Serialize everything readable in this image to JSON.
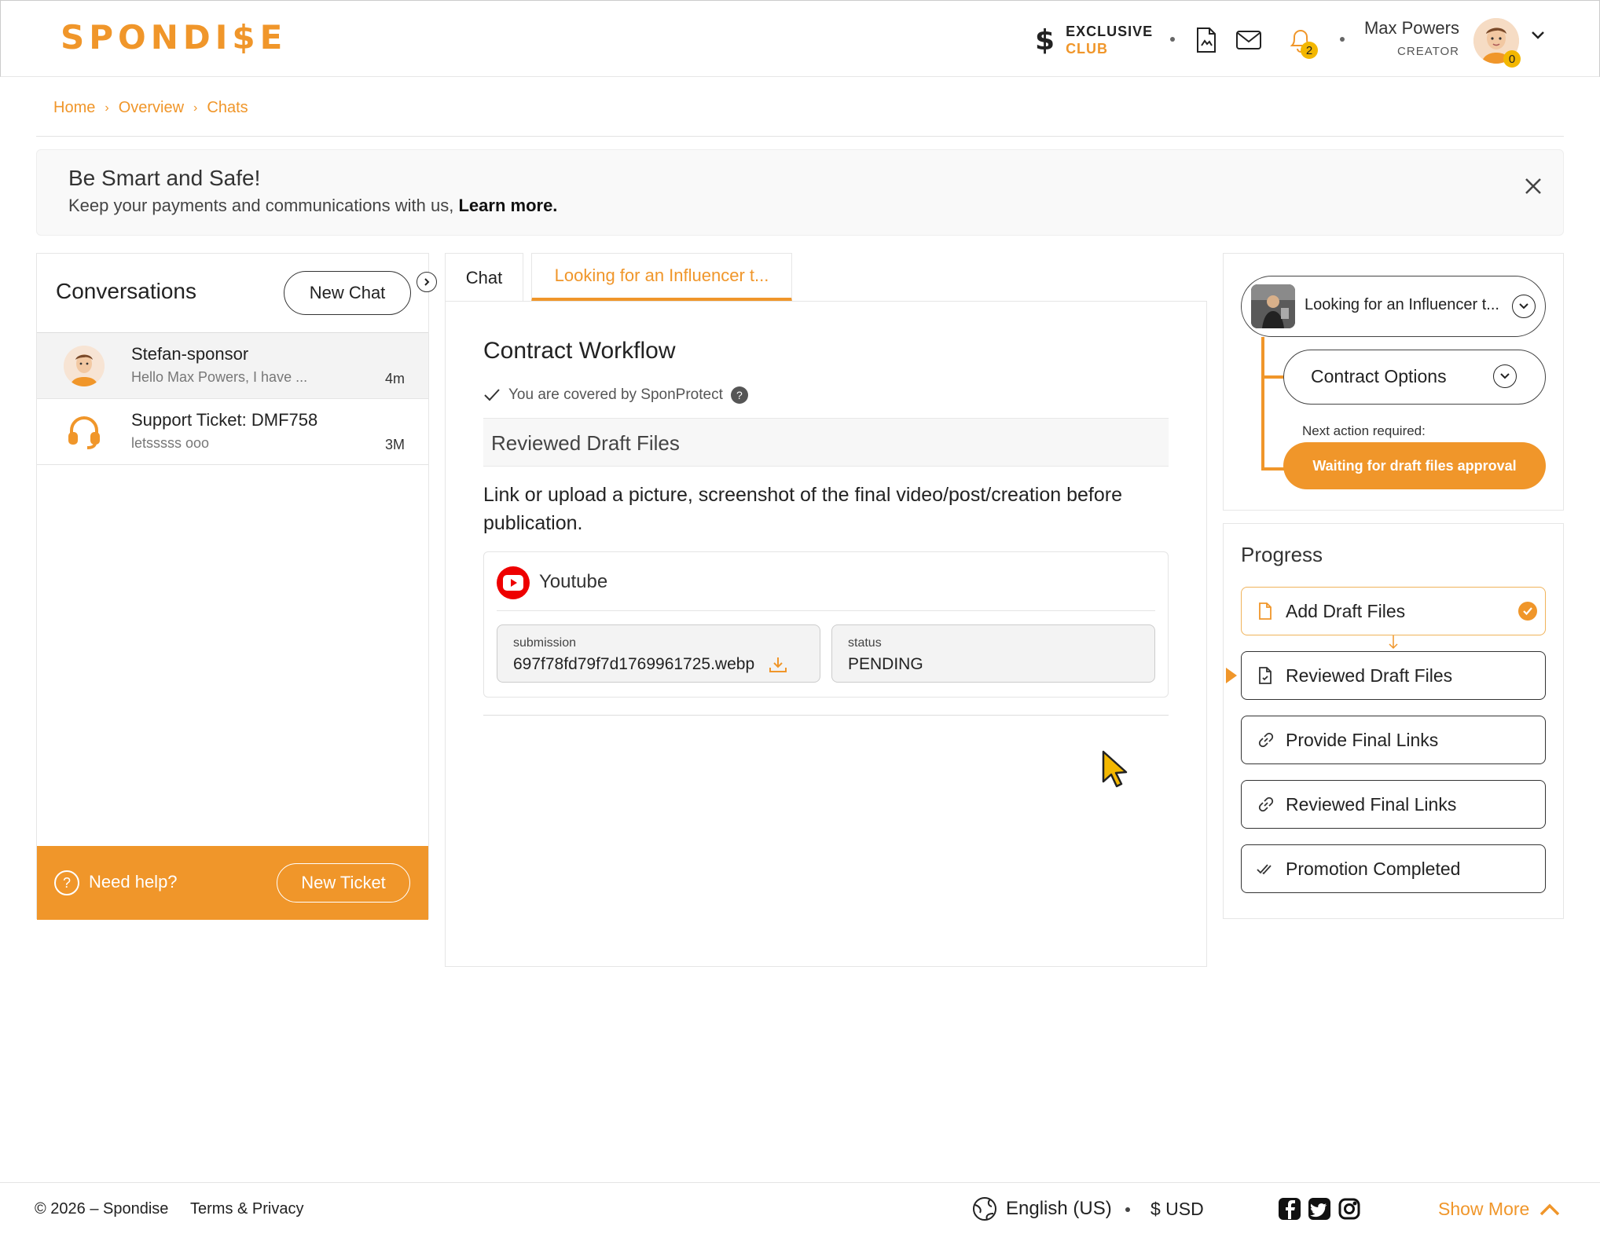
{
  "header": {
    "logo_text": "SPONDI$E",
    "club_line1": "EXCLUSIVE",
    "club_line2": "CLUB",
    "notifications_count": "2",
    "user_name": "Max Powers",
    "user_role": "CREATOR",
    "avatar_badge": "0"
  },
  "breadcrumb": [
    "Home",
    "Overview",
    "Chats"
  ],
  "banner": {
    "title": "Be Smart and Safe!",
    "text": "Keep your payments and communications with us,",
    "link": "Learn more."
  },
  "conversations": {
    "title": "Conversations",
    "new_chat_label": "New Chat",
    "items": [
      {
        "name": "Stefan-sponsor",
        "preview": "Hello Max Powers, I have ...",
        "time": "4m"
      },
      {
        "name": "Support Ticket: DMF758",
        "preview": "letsssss ooo",
        "time": "3M"
      }
    ],
    "help_label": "Need help?",
    "new_ticket_label": "New Ticket"
  },
  "tabs": {
    "chat": "Chat",
    "active": "Looking for an Influencer t..."
  },
  "workflow": {
    "title": "Contract Workflow",
    "covered_text": "You are covered by SponProtect",
    "step_title": "Reviewed Draft Files",
    "instructions": "Link or upload a picture, screenshot of the final video/post/creation before publication.",
    "platform": "Youtube",
    "submission_label": "submission",
    "submission_value": "697f78fd79f7d1769961725.webp",
    "status_label": "status",
    "status_value": "PENDING"
  },
  "contract_panel": {
    "project_label": "Looking for an Influencer t...",
    "options_label": "Contract Options",
    "next_action_label": "Next action required:",
    "next_action_button": "Waiting for draft files approval"
  },
  "progress": {
    "title": "Progress",
    "steps": [
      {
        "label": "Add Draft Files",
        "state": "done"
      },
      {
        "label": "Reviewed Draft Files",
        "state": "current"
      },
      {
        "label": "Provide Final Links",
        "state": "pending"
      },
      {
        "label": "Reviewed Final Links",
        "state": "pending"
      },
      {
        "label": "Promotion Completed",
        "state": "pending"
      }
    ]
  },
  "footer": {
    "copyright": "© 2026 – Spondise",
    "terms": "Terms & Privacy",
    "language": "English (US)",
    "currency": "$ USD",
    "show_more": "Show More"
  },
  "colors": {
    "accent": "#f0962a",
    "badge": "#f3b700",
    "youtube": "#e00000"
  }
}
